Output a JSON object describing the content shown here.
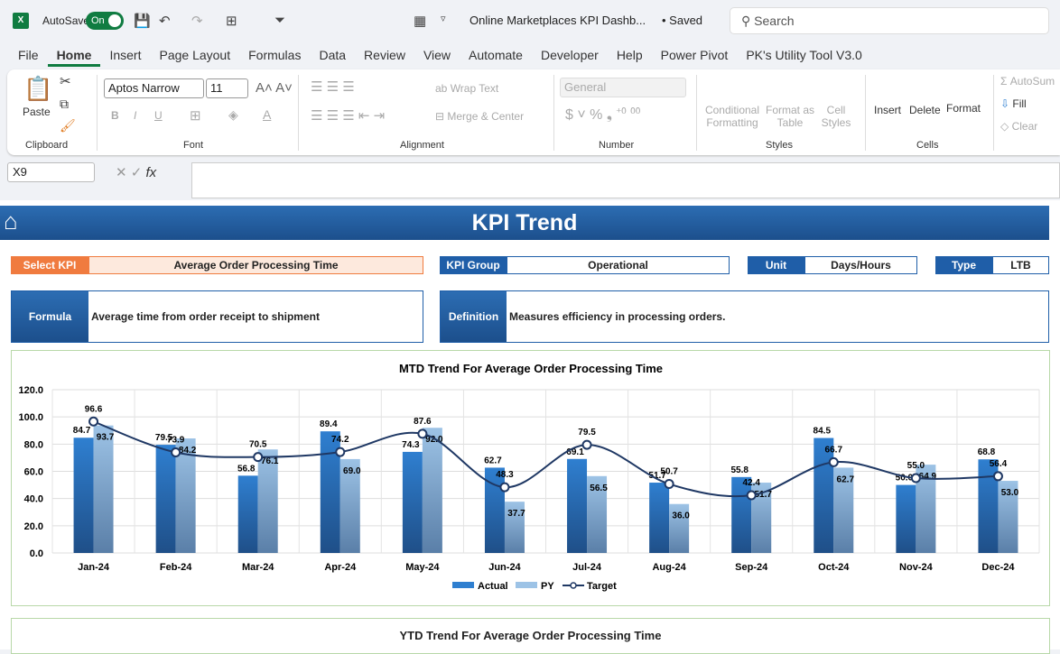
{
  "titlebar": {
    "autosave": "AutoSave",
    "toggle": "On",
    "doc_title": "Online Marketplaces KPI Dashb...",
    "saved": "• Saved",
    "search_placeholder": "Search"
  },
  "tabs": [
    "File",
    "Home",
    "Insert",
    "Page Layout",
    "Formulas",
    "Data",
    "Review",
    "View",
    "Automate",
    "Developer",
    "Help",
    "Power Pivot",
    "PK's Utility Tool V3.0"
  ],
  "ribbon": {
    "paste": "Paste",
    "clipboard": "Clipboard",
    "font_name": "Aptos Narrow",
    "font_size": "11",
    "font": "Font",
    "wrap_text": "Wrap Text",
    "merge_center": "Merge & Center",
    "alignment": "Alignment",
    "number_format": "General",
    "number": "Number",
    "conditional_formatting": "Conditional Formatting",
    "format_as_table": "Format as Table",
    "cell_styles": "Cell Styles",
    "styles": "Styles",
    "insert": "Insert",
    "delete": "Delete",
    "format": "Format",
    "cells": "Cells",
    "autosum": "AutoSum",
    "fill": "Fill",
    "clear": "Clear"
  },
  "formula_bar": {
    "name_box": "X9",
    "formula": ""
  },
  "dashboard": {
    "title": "KPI Trend",
    "select_kpi_label": "Select KPI",
    "select_kpi_value": "Average Order Processing Time",
    "kpi_group_label": "KPI Group",
    "kpi_group_value": "Operational",
    "unit_label": "Unit",
    "unit_value": "Days/Hours",
    "type_label": "Type",
    "type_value": "LTB",
    "formula_label": "Formula",
    "formula_value": "Average time from order receipt to shipment",
    "definition_label": "Definition",
    "definition_value": "Measures efficiency in processing orders.",
    "ytd_title": "YTD Trend For Average Order Processing Time"
  },
  "colors": {
    "accent": "#1f5ea8",
    "select_kpi": "#f07b3f",
    "actual": "#2f7fd0",
    "py": "#9dc3e6",
    "target": "#1f3864",
    "excel_green": "#107c41"
  },
  "chart_data": {
    "type": "bar",
    "title": "MTD Trend For Average Order Processing Time",
    "categories": [
      "Jan-24",
      "Feb-24",
      "Mar-24",
      "Apr-24",
      "May-24",
      "Jun-24",
      "Jul-24",
      "Aug-24",
      "Sep-24",
      "Oct-24",
      "Nov-24",
      "Dec-24"
    ],
    "ylim": [
      0,
      120
    ],
    "yticks": [
      "0.0",
      "20.0",
      "40.0",
      "60.0",
      "80.0",
      "100.0",
      "120.0"
    ],
    "grid": true,
    "legend": "bottom",
    "series": [
      {
        "name": "Actual",
        "type": "bar",
        "values": [
          84.7,
          79.5,
          56.8,
          89.4,
          74.3,
          62.7,
          69.1,
          51.7,
          55.8,
          84.5,
          50.0,
          68.8
        ]
      },
      {
        "name": "PY",
        "type": "bar",
        "values": [
          93.7,
          84.2,
          76.1,
          69.0,
          92.0,
          37.7,
          56.5,
          36.0,
          51.7,
          62.7,
          64.9,
          53.0
        ]
      },
      {
        "name": "Target",
        "type": "line",
        "values": [
          96.6,
          73.9,
          70.5,
          74.2,
          87.6,
          48.3,
          79.5,
          50.7,
          42.4,
          66.7,
          55.0,
          56.4
        ]
      }
    ]
  }
}
